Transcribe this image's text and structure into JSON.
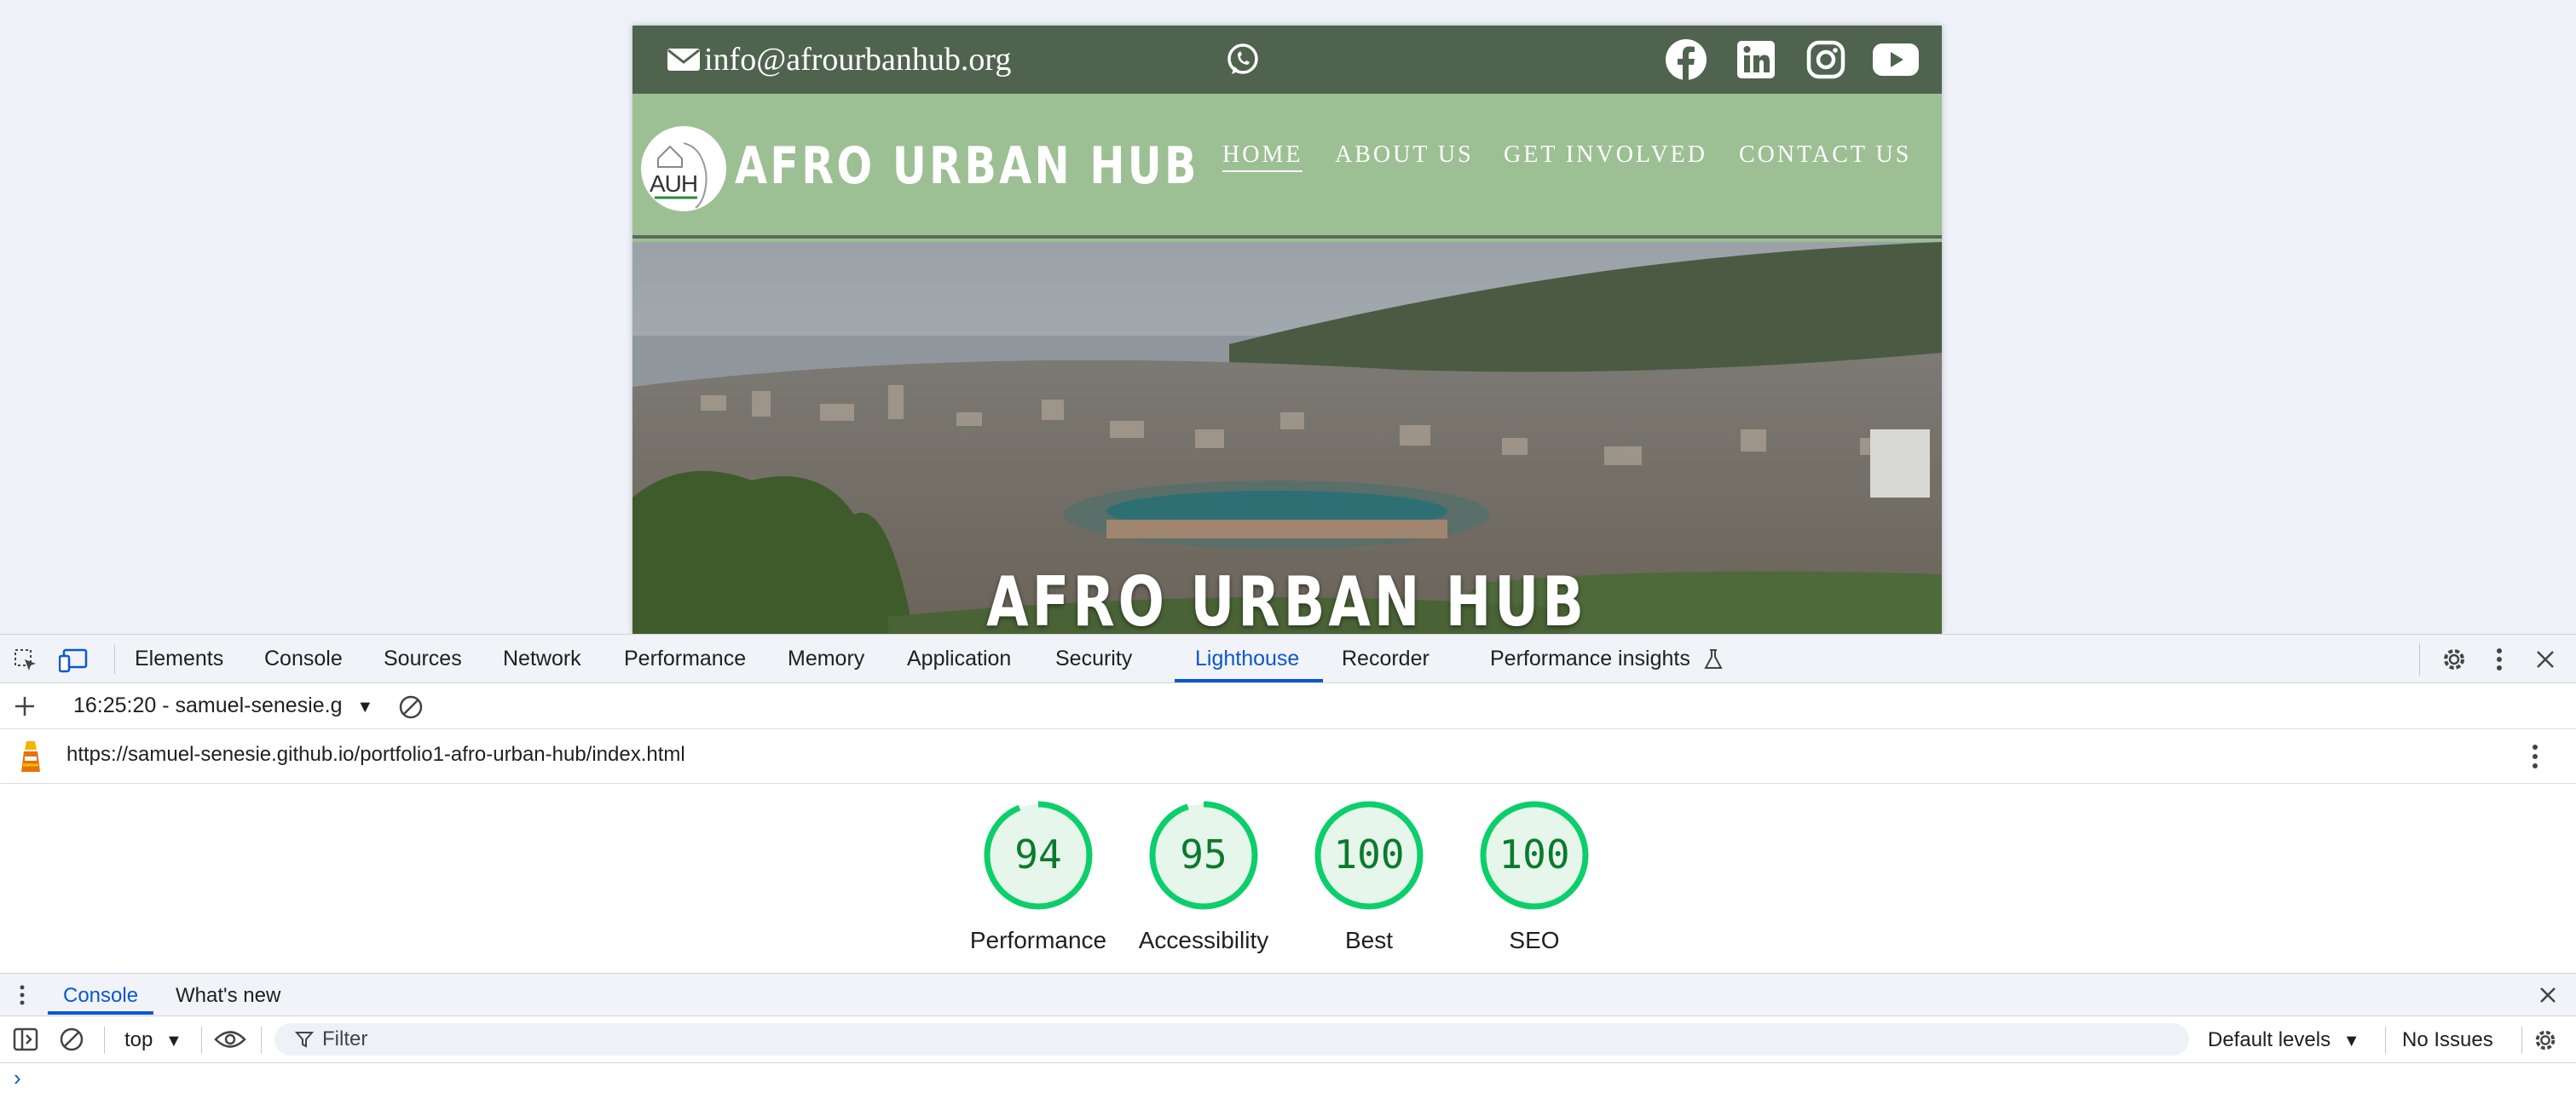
{
  "site": {
    "email": "info@afrourbanhub.org",
    "logo_text": "AUH",
    "brand": "AFRO URBAN HUB",
    "nav": [
      {
        "label": "HOME",
        "active": true
      },
      {
        "label": "ABOUT US",
        "active": false
      },
      {
        "label": "GET INVOLVED",
        "active": false
      },
      {
        "label": "CONTACT US",
        "active": false
      }
    ],
    "social_icons": [
      "facebook-icon",
      "linkedin-icon",
      "instagram-icon",
      "youtube-icon"
    ],
    "hero_title": "AFRO URBAN HUB",
    "colors": {
      "topbar": "#4f634f",
      "navbar": "#9dbf94"
    }
  },
  "devtools": {
    "tabs": [
      {
        "label": "Elements",
        "active": false
      },
      {
        "label": "Console",
        "active": false
      },
      {
        "label": "Sources",
        "active": false
      },
      {
        "label": "Network",
        "active": false
      },
      {
        "label": "Performance",
        "active": false
      },
      {
        "label": "Memory",
        "active": false
      },
      {
        "label": "Application",
        "active": false
      },
      {
        "label": "Security",
        "active": false
      },
      {
        "label": "Lighthouse",
        "active": true
      },
      {
        "label": "Recorder",
        "active": false
      },
      {
        "label": "Performance insights",
        "active": false
      }
    ],
    "report_select": "16:25:20 - samuel-senesie.g",
    "url": "https://samuel-senesie.github.io/portfolio1-afro-urban-hub/index.html",
    "scores": [
      {
        "label": "Performance",
        "value": 94
      },
      {
        "label": "Accessibility",
        "value": 95
      },
      {
        "label": "Best",
        "value": 100
      },
      {
        "label": "SEO",
        "value": 100
      }
    ],
    "score_color": "#0c7a2e",
    "drawer_tabs": [
      {
        "label": "Console",
        "active": true
      },
      {
        "label": "What's new",
        "active": false
      }
    ],
    "context": "top",
    "filter_placeholder": "Filter",
    "levels": "Default levels",
    "issues": "No Issues",
    "accent": "#0b57d0"
  }
}
